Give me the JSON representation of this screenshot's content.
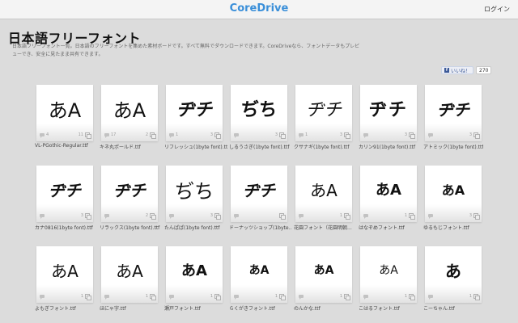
{
  "header": {
    "brand": "CoreDrive",
    "login": "ログイン"
  },
  "page": {
    "title": "日本語フリーフォント",
    "description": "日本語フリーフォント一覧。日本語のフリーフォントを集めた素材ボードです。すべて無料でダウンロードできます。CoreDriveなら、フォントデータもプレビューでき、安全に見たまま共有できます。"
  },
  "facebook": {
    "like_label": "いいね！",
    "count": "270"
  },
  "tiles": [
    {
      "sample": "あA",
      "label": "VL-PGothic-Regular.ttf",
      "comments": "4",
      "copies": "11"
    },
    {
      "sample": "あA",
      "label": "キネ丸ポールド.ttf",
      "comments": "17",
      "copies": "2"
    },
    {
      "sample": "ヂチ",
      "label": "リフレッシュ(1byte font).ttf",
      "comments": "1",
      "copies": "3"
    },
    {
      "sample": "ぢち",
      "label": "しるうさぎ(1byte font).ttf",
      "comments": "",
      "copies": "3"
    },
    {
      "sample": "ヂチ",
      "label": "クサナギ(1byte font).ttf",
      "comments": "1",
      "copies": "3"
    },
    {
      "sample": "ヂチ",
      "label": "カリン91(1byte font).ttf",
      "comments": "",
      "copies": "3"
    },
    {
      "sample": "ヂチ",
      "label": "アトミック(1byte font).ttf",
      "comments": "",
      "copies": "3"
    },
    {
      "sample": "ヂチ",
      "label": "カナ0816(1byte font).ttf",
      "comments": "",
      "copies": "3"
    },
    {
      "sample": "ヂチ",
      "label": "リラックス(1byte font).ttf",
      "comments": "",
      "copies": "2"
    },
    {
      "sample": "ぢち",
      "label": "たんぱぱ(1byte font).ttf",
      "comments": "",
      "copies": "3"
    },
    {
      "sample": "ヂチ",
      "label": "ドーナッツショップ(1byte...",
      "comments": "",
      "copies": ""
    },
    {
      "sample": "あA",
      "label": "花園フォント（花園明朝...",
      "comments": "",
      "copies": "1"
    },
    {
      "sample": "あA",
      "label": "はなぞめフォント.ttf",
      "comments": "",
      "copies": "1"
    },
    {
      "sample": "あA",
      "label": "ゆるもじフォント.ttf",
      "comments": "",
      "copies": "3"
    },
    {
      "sample": "あA",
      "label": "よもぎフォント.ttf",
      "comments": "",
      "copies": "1"
    },
    {
      "sample": "あA",
      "label": "ほにゃ字.ttf",
      "comments": "",
      "copies": "1"
    },
    {
      "sample": "あA",
      "label": "瀬戸フォント.ttf",
      "comments": "",
      "copies": "1"
    },
    {
      "sample": "あA",
      "label": "らくがきフォント.ttf",
      "comments": "",
      "copies": "1"
    },
    {
      "sample": "あA",
      "label": "のんかな.ttf",
      "comments": "",
      "copies": "1"
    },
    {
      "sample": "あA",
      "label": "こはるフォント.ttf",
      "comments": "",
      "copies": "1"
    },
    {
      "sample": "あ",
      "label": "こーちゃん.ttf",
      "comments": "",
      "copies": "1"
    }
  ]
}
